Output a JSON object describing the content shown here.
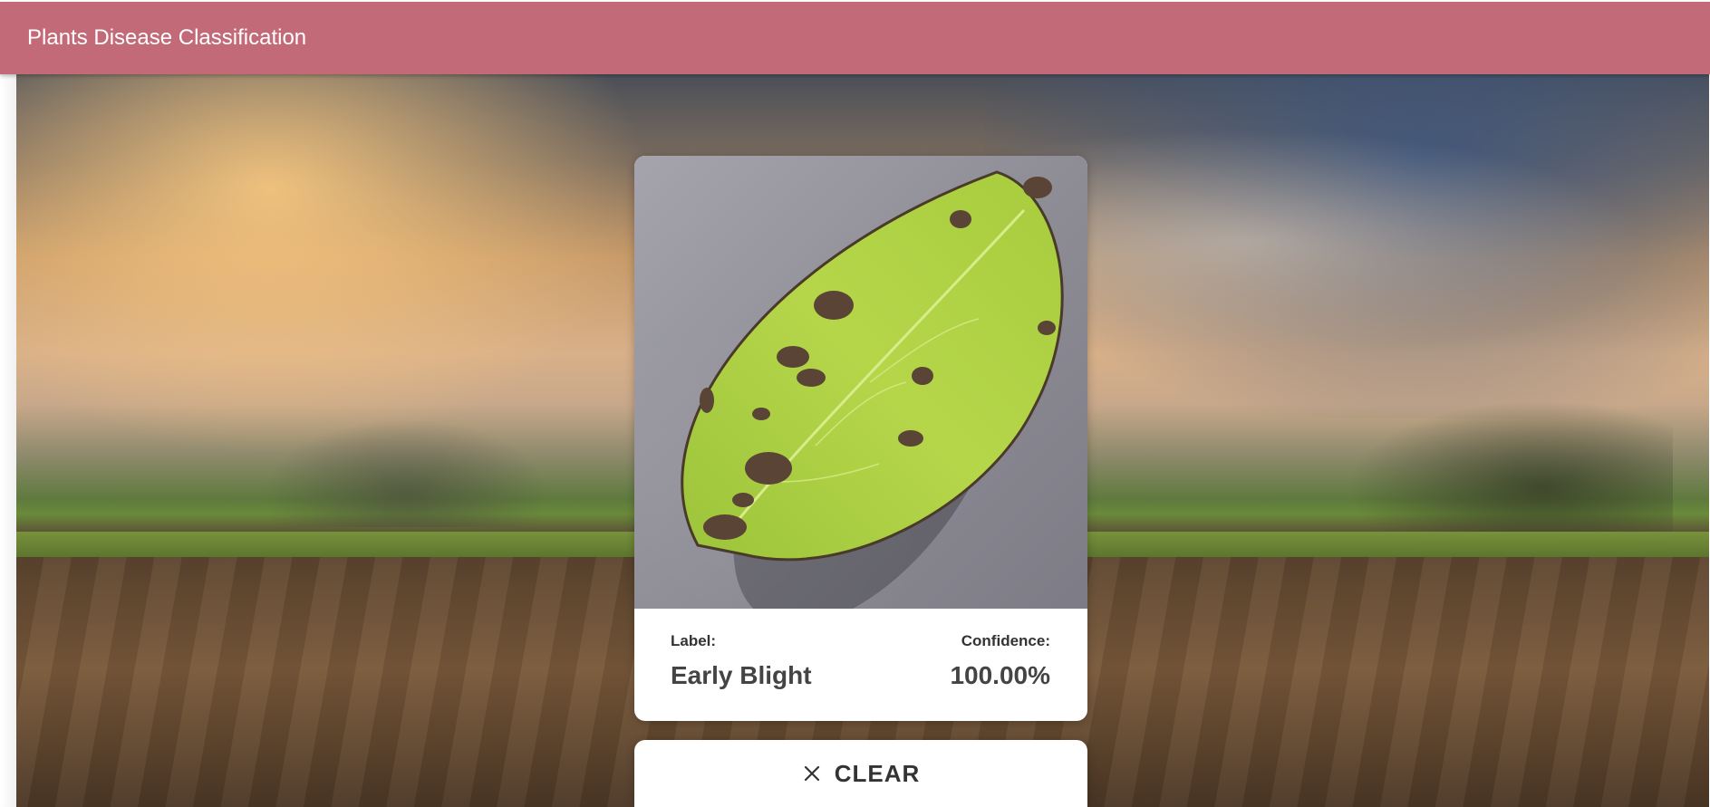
{
  "app": {
    "title": "Plants Disease Classification",
    "appbar_color": "#c26a78"
  },
  "result": {
    "image_alt": "Uploaded leaf image",
    "label_title": "Label:",
    "label_value": "Early Blight",
    "confidence_title": "Confidence:",
    "confidence_value": "100.00%"
  },
  "actions": {
    "clear_label": "CLEAR",
    "clear_icon": "close-icon"
  },
  "background": {
    "description_icon": "farm-field-background"
  }
}
